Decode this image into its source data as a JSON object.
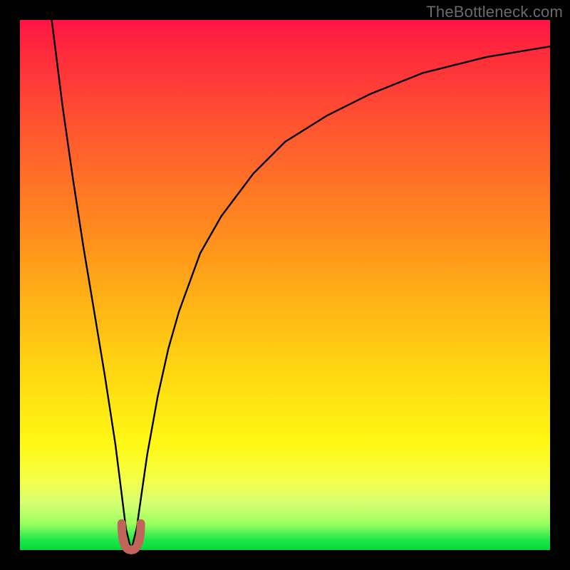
{
  "watermark": "TheBottleneck.com",
  "gradient": {
    "top": "#ff1445",
    "mid1": "#ff8c1e",
    "mid2": "#fff814",
    "bottom": "#00d838"
  },
  "chart_data": {
    "type": "line",
    "title": "",
    "xlabel": "",
    "ylabel": "",
    "xlim": [
      0,
      100
    ],
    "ylim": [
      0,
      100
    ],
    "x_min_point": 21,
    "series": [
      {
        "name": "curve",
        "x": [
          6,
          8,
          10,
          12,
          14,
          16,
          18,
          19,
          20,
          21,
          22,
          23,
          24,
          26,
          28,
          30,
          34,
          38,
          44,
          50,
          58,
          66,
          76,
          88,
          100
        ],
        "y": [
          100,
          84,
          70,
          57,
          45,
          33,
          20,
          12,
          4,
          0,
          4,
          11,
          18,
          29,
          38,
          45,
          56,
          63,
          71,
          77,
          82,
          86,
          90,
          93,
          95
        ]
      }
    ],
    "marker": {
      "x_range": [
        19.2,
        22.8
      ],
      "y_range": [
        0,
        5
      ],
      "color": "#c1645a"
    }
  }
}
